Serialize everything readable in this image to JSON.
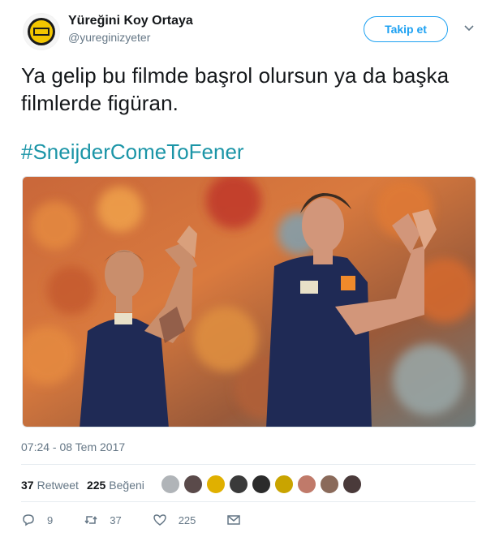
{
  "account": {
    "display_name": "Yüreğini Koy Ortaya",
    "handle": "@yureginizyeter"
  },
  "follow_label": "Takip et",
  "tweet": {
    "text": "Ya gelip bu filmde başrol olursun ya da başka filmlerde figüran.",
    "hashtag": "#SneijderComeToFener",
    "timestamp": "07:24 - 08 Tem 2017"
  },
  "stats": {
    "retweets_count": "37",
    "retweets_label": "Retweet",
    "likes_count": "225",
    "likes_label": "Beğeni"
  },
  "actions": {
    "reply_count": "9",
    "retweet_count": "37",
    "like_count": "225"
  },
  "colors": {
    "accent": "#1da1f2",
    "hashtag": "#1b95a7",
    "muted": "#657786"
  },
  "icons": [
    "reply-icon",
    "retweet-icon",
    "heart-icon",
    "message-icon",
    "chevron-down-icon"
  ]
}
